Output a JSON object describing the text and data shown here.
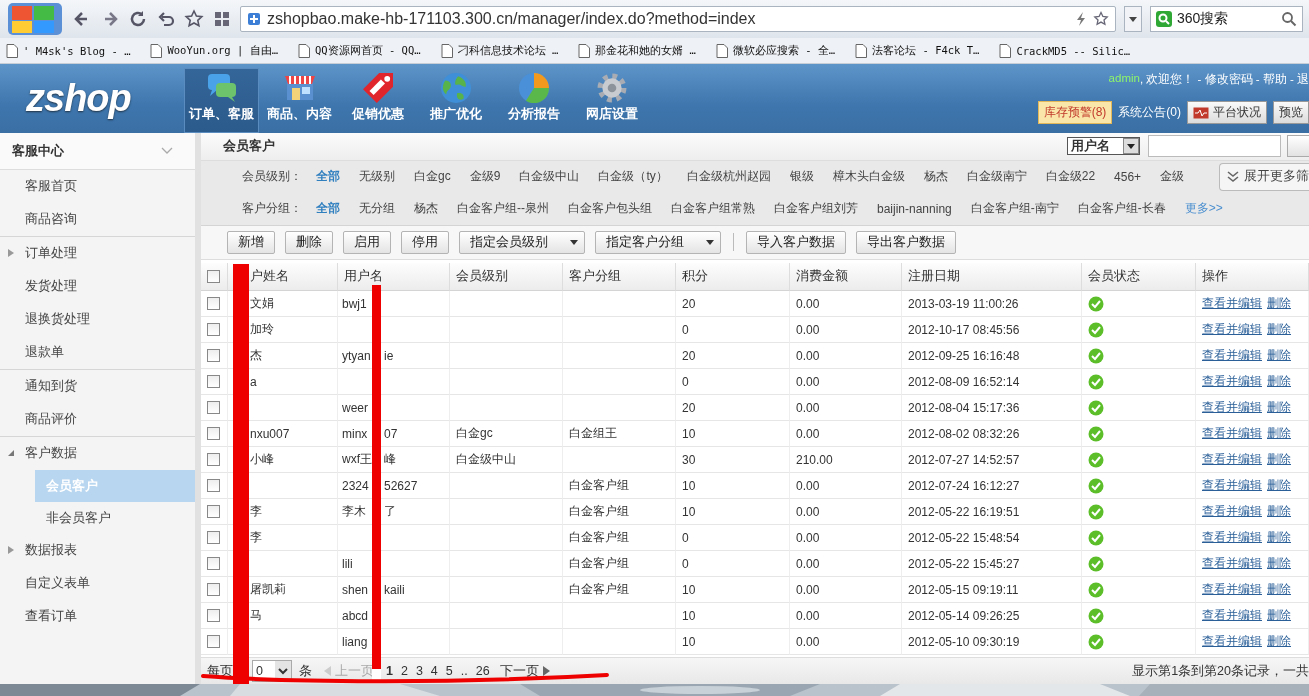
{
  "browser": {
    "address": "zshopbao.make-hb-171103.300.cn/manager/index.do?method=index",
    "search_placeholder": "360搜索",
    "bookmarks": [
      "'  M4sk's Blog - …",
      "WooYun.org | 自由…",
      "QQ资源网首页 - QQ…",
      "刁科信息技术论坛 …",
      "那金花和她的女婿 …",
      "微软必应搜索 - 全…",
      "法客论坛 - F4ck T…",
      "CrackMD5 -- Silic…"
    ]
  },
  "header": {
    "logo": "zshop",
    "nav": [
      {
        "label": "订单、客服",
        "selected": true
      },
      {
        "label": "商品、内容",
        "selected": false
      },
      {
        "label": "促销优惠",
        "selected": false
      },
      {
        "label": "推广优化",
        "selected": false
      },
      {
        "label": "分析报告",
        "selected": false
      },
      {
        "label": "网店设置",
        "selected": false
      }
    ],
    "user": "admin",
    "user_links": ", 欢迎您！ - 修改密码 - 帮助 - 退",
    "buttons": [
      {
        "label": "库存预警(8)",
        "kind": "warning"
      },
      {
        "label": "系统公告(0)",
        "kind": "link"
      },
      {
        "label": "平台状况",
        "kind": "monitor"
      },
      {
        "label": "预览",
        "kind": "button"
      }
    ]
  },
  "sidebar": {
    "title": "客服中心",
    "sections": [
      {
        "items": [
          {
            "label": "客服首页",
            "selected": false
          },
          {
            "label": "商品咨询",
            "selected": false
          }
        ]
      },
      {
        "items": [
          {
            "label": "订单处理",
            "selected": false,
            "expanded": false
          },
          {
            "label": "发货处理",
            "selected": false
          },
          {
            "label": "退换货处理",
            "selected": false
          },
          {
            "label": "退款单",
            "selected": false
          }
        ]
      },
      {
        "items": [
          {
            "label": "通知到货",
            "selected": false
          },
          {
            "label": "商品评价",
            "selected": false
          }
        ]
      },
      {
        "items": [
          {
            "label": "客户数据",
            "selected": false,
            "expanded": true,
            "children": [
              {
                "label": "会员客户",
                "selected": true
              },
              {
                "label": "非会员客户",
                "selected": false
              }
            ]
          },
          {
            "label": "数据报表",
            "selected": false,
            "expanded": false
          },
          {
            "label": "自定义表单",
            "selected": false
          },
          {
            "label": "查看订单",
            "selected": false
          }
        ]
      }
    ]
  },
  "main": {
    "title": "会员客户",
    "search_field": "用户名",
    "filters": [
      {
        "label": "会员级别：",
        "options": [
          {
            "label": "全部",
            "selected": true
          },
          {
            "label": "无级别",
            "selected": false
          },
          {
            "label": "白金gc",
            "selected": false
          },
          {
            "label": "金级9",
            "selected": false
          },
          {
            "label": "白金级中山",
            "selected": false
          },
          {
            "label": "白金级（ty）",
            "selected": false
          },
          {
            "label": "白金级杭州赵园",
            "selected": false
          },
          {
            "label": "银级",
            "selected": false
          },
          {
            "label": "樟木头白金级",
            "selected": false
          },
          {
            "label": "杨杰",
            "selected": false
          },
          {
            "label": "白金级南宁",
            "selected": false
          },
          {
            "label": "白金级22",
            "selected": false
          },
          {
            "label": "456+",
            "selected": false
          },
          {
            "label": "金级",
            "selected": false
          }
        ],
        "expand": "展开更多筛"
      },
      {
        "label": "客户分组：",
        "options": [
          {
            "label": "全部",
            "selected": true
          },
          {
            "label": "无分组",
            "selected": false
          },
          {
            "label": "杨杰",
            "selected": false
          },
          {
            "label": "白金客户组--泉州",
            "selected": false
          },
          {
            "label": "白金客户包头组",
            "selected": false
          },
          {
            "label": "白金客户组常熟",
            "selected": false
          },
          {
            "label": "白金客户组刘芳",
            "selected": false
          },
          {
            "label": "baijin-nanning",
            "selected": false
          },
          {
            "label": "白金客户组-南宁",
            "selected": false
          },
          {
            "label": "白金客户组-长春",
            "selected": false
          }
        ],
        "more": "更多>>"
      }
    ],
    "toolbar": [
      {
        "kind": "button",
        "label": "新增"
      },
      {
        "kind": "button",
        "label": "删除"
      },
      {
        "kind": "button",
        "label": "启用"
      },
      {
        "kind": "button",
        "label": "停用"
      },
      {
        "kind": "dropdown",
        "label": "指定会员级别"
      },
      {
        "kind": "dropdown",
        "label": "指定客户分组"
      },
      {
        "kind": "separator"
      },
      {
        "kind": "button",
        "label": "导入客户数据"
      },
      {
        "kind": "button",
        "label": "导出客户数据"
      }
    ],
    "table": {
      "select_all_checked": false,
      "columns": [
        "户姓名",
        "用户名",
        "会员级别",
        "客户分组",
        "积分",
        "消费金额",
        "注册日期",
        "会员状态",
        "操作"
      ],
      "rows": [
        {
          "checked": false,
          "name": "文娟",
          "user": "bwj1",
          "points": "20",
          "amount": "0.00",
          "date": "2013-03-19 11:00:26",
          "active": true,
          "actions": [
            "查看并编辑",
            "删除"
          ]
        },
        {
          "checked": false,
          "name": "加玲",
          "points": "0",
          "amount": "0.00",
          "date": "2012-10-17 08:45:56",
          "active": true,
          "actions": [
            "查看并编辑",
            "删除"
          ]
        },
        {
          "checked": false,
          "name": "杰",
          "user": "ytyan",
          "user_tail": "ie",
          "points": "20",
          "amount": "0.00",
          "date": "2012-09-25 16:16:48",
          "active": true,
          "actions": [
            "查看并编辑",
            "删除"
          ]
        },
        {
          "checked": false,
          "name": "a",
          "points": "0",
          "amount": "0.00",
          "date": "2012-08-09 16:52:14",
          "active": true,
          "actions": [
            "查看并编辑",
            "删除"
          ]
        },
        {
          "checked": false,
          "user": "weer",
          "points": "20",
          "amount": "0.00",
          "date": "2012-08-04 15:17:36",
          "active": true,
          "actions": [
            "查看并编辑",
            "删除"
          ]
        },
        {
          "checked": false,
          "name": "nxu007",
          "user": "minx",
          "user_tail": "07",
          "level": "白金gc",
          "group": "白金组王",
          "points": "10",
          "amount": "0.00",
          "date": "2012-08-02 08:32:26",
          "active": true,
          "actions": [
            "查看并编辑",
            "删除"
          ]
        },
        {
          "checked": false,
          "name": "小峰",
          "user": "wxf王",
          "user_tail": "峰",
          "level": "白金级中山",
          "points": "30",
          "amount": "210.00",
          "date": "2012-07-27 14:52:57",
          "active": true,
          "actions": [
            "查看并编辑",
            "删除"
          ]
        },
        {
          "checked": false,
          "user": "2324",
          "user_tail": "52627",
          "group": "白金客户组",
          "points": "10",
          "amount": "0.00",
          "date": "2012-07-24 16:12:27",
          "active": true,
          "actions": [
            "查看并编辑",
            "删除"
          ]
        },
        {
          "checked": false,
          "name": "李",
          "user": "李木",
          "user_tail": "了",
          "group": "白金客户组",
          "points": "10",
          "amount": "0.00",
          "date": "2012-05-22 16:19:51",
          "active": true,
          "actions": [
            "查看并编辑",
            "删除"
          ]
        },
        {
          "checked": false,
          "name": "李",
          "group": "白金客户组",
          "points": "0",
          "amount": "0.00",
          "date": "2012-05-22 15:48:54",
          "active": true,
          "actions": [
            "查看并编辑",
            "删除"
          ]
        },
        {
          "checked": false,
          "user": "lili",
          "group": "白金客户组",
          "points": "0",
          "amount": "0.00",
          "date": "2012-05-22 15:45:27",
          "active": true,
          "actions": [
            "查看并编辑",
            "删除"
          ]
        },
        {
          "checked": false,
          "name": "屠凯莉",
          "user": "shen",
          "user_tail": "kaili",
          "group": "白金客户组",
          "points": "10",
          "amount": "0.00",
          "date": "2012-05-15 09:19:11",
          "active": true,
          "actions": [
            "查看并编辑",
            "删除"
          ]
        },
        {
          "checked": false,
          "name": "马",
          "user": "abcd",
          "points": "10",
          "amount": "0.00",
          "date": "2012-05-14 09:26:25",
          "active": true,
          "actions": [
            "查看并编辑",
            "删除"
          ]
        },
        {
          "checked": false,
          "user": "liang",
          "points": "10",
          "amount": "0.00",
          "date": "2012-05-10 09:30:19",
          "active": true,
          "actions": [
            "查看并编辑",
            "删除"
          ]
        }
      ]
    },
    "pagination": {
      "per_page_label": "每页",
      "per_page": "0",
      "unit": "条",
      "prev": "上一页",
      "pages": [
        {
          "label": "1",
          "selected": true
        },
        {
          "label": "2",
          "selected": false
        },
        {
          "label": "3",
          "selected": false
        },
        {
          "label": "4",
          "selected": false
        },
        {
          "label": "5",
          "selected": false
        }
      ],
      "ellipsis": "..",
      "last": "26",
      "next": "下一页",
      "summary": "显示第1条到第20条记录，一共"
    }
  }
}
